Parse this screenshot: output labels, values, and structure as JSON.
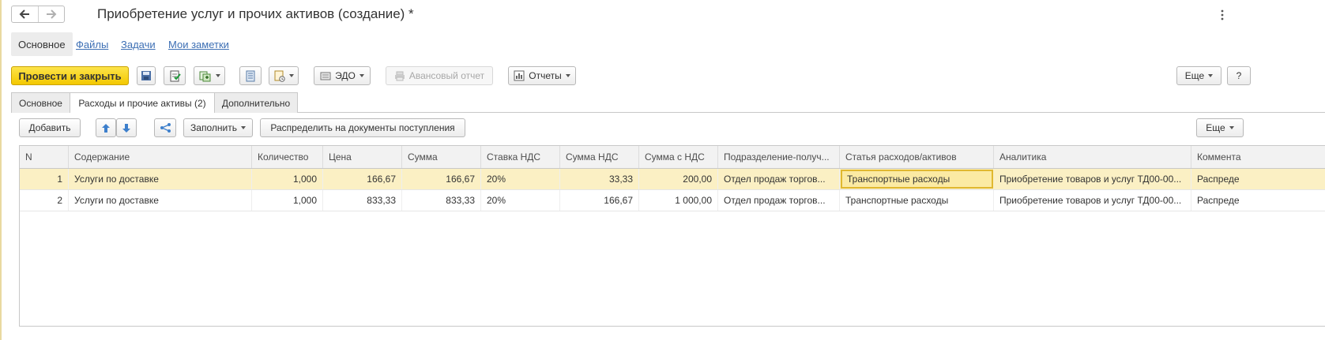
{
  "header": {
    "title": "Приобретение услуг и прочих активов (создание) *",
    "back_icon": "arrow-left-icon",
    "forward_icon": "arrow-right-icon"
  },
  "sections": {
    "active": "Основное",
    "links": [
      "Файлы",
      "Задачи",
      "Мои заметки"
    ]
  },
  "toolbar": {
    "post_close": "Провести и закрыть",
    "edo": "ЭДО",
    "advance_report": "Авансовый отчет",
    "reports": "Отчеты",
    "more": "Еще",
    "help": "?"
  },
  "tabs": [
    "Основное",
    "Расходы и прочие активы (2)",
    "Дополнительно"
  ],
  "table_toolbar": {
    "add": "Добавить",
    "fill": "Заполнить",
    "distribute": "Распределить на документы поступления",
    "more": "Еще"
  },
  "table": {
    "columns": [
      "N",
      "Содержание",
      "Количество",
      "Цена",
      "Сумма",
      "Ставка НДС",
      "Сумма НДС",
      "Сумма с НДС",
      "Подразделение-получ...",
      "Статья расходов/активов",
      "Аналитика",
      "Коммента"
    ],
    "rows": [
      [
        "1",
        "Услуги по доставке",
        "1,000",
        "166,67",
        "166,67",
        "20%",
        "33,33",
        "200,00",
        "Отдел продаж торгов...",
        "Транспортные расходы",
        "Приобретение товаров и услуг ТД00-00...",
        "Распреде"
      ],
      [
        "2",
        "Услуги по доставке",
        "1,000",
        "833,33",
        "833,33",
        "20%",
        "166,67",
        "1 000,00",
        "Отдел продаж торгов...",
        "Транспортные расходы",
        "Приобретение товаров и услуг ТД00-00...",
        "Распреде"
      ]
    ]
  },
  "colors": {
    "primary_button": "#f3c800",
    "link": "#3d6fb4",
    "selected_row": "#fbf0c4",
    "focus_cell_border": "#e0b830"
  }
}
